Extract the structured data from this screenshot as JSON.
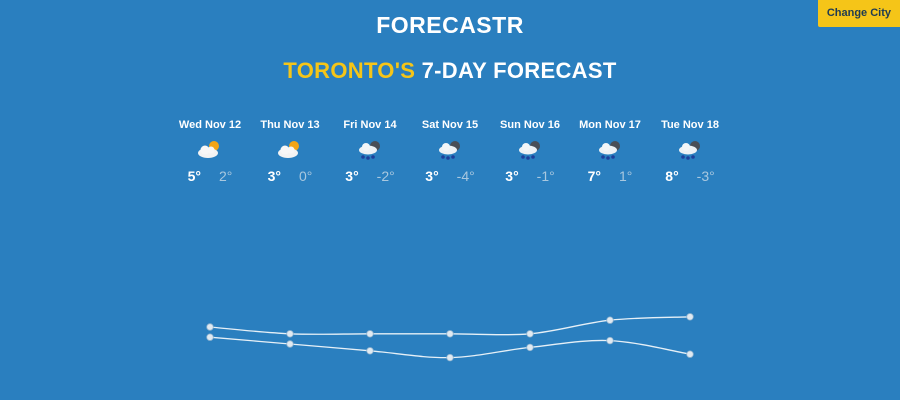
{
  "header": {
    "app_title": "FORECASTR",
    "change_city_label": "Change City",
    "city": "TORONTO'S",
    "heading_rest": " 7-DAY FORECAST"
  },
  "forecast": [
    {
      "day": "Wed Nov 12",
      "icon": "partly-sunny-icon",
      "high": "5°",
      "low": "2°"
    },
    {
      "day": "Thu Nov 13",
      "icon": "partly-sunny-icon",
      "high": "3°",
      "low": "0°"
    },
    {
      "day": "Fri Nov 14",
      "icon": "snow-cloud-icon",
      "high": "3°",
      "low": "-2°"
    },
    {
      "day": "Sat Nov 15",
      "icon": "snow-cloud-icon",
      "high": "3°",
      "low": "-4°"
    },
    {
      "day": "Sun Nov 16",
      "icon": "snow-cloud-icon",
      "high": "3°",
      "low": "-1°"
    },
    {
      "day": "Mon Nov 17",
      "icon": "snow-cloud-icon",
      "high": "7°",
      "low": "1°"
    },
    {
      "day": "Tue Nov 18",
      "icon": "snow-cloud-icon",
      "high": "8°",
      "low": "-3°"
    }
  ],
  "chart_data": {
    "type": "line",
    "categories": [
      "Wed Nov 12",
      "Thu Nov 13",
      "Fri Nov 14",
      "Sat Nov 15",
      "Sun Nov 16",
      "Mon Nov 17",
      "Tue Nov 18"
    ],
    "series": [
      {
        "values": [
          5,
          3,
          3,
          3,
          3,
          7,
          8
        ]
      },
      {
        "values": [
          2,
          0,
          -2,
          -4,
          -1,
          1,
          -3
        ]
      }
    ],
    "line_color": "#e6f0f7",
    "point_color": "#dfe9f1"
  },
  "colors": {
    "background": "#2a7fbf",
    "accent": "#f5c518",
    "low_temp": "#a9c8df"
  }
}
